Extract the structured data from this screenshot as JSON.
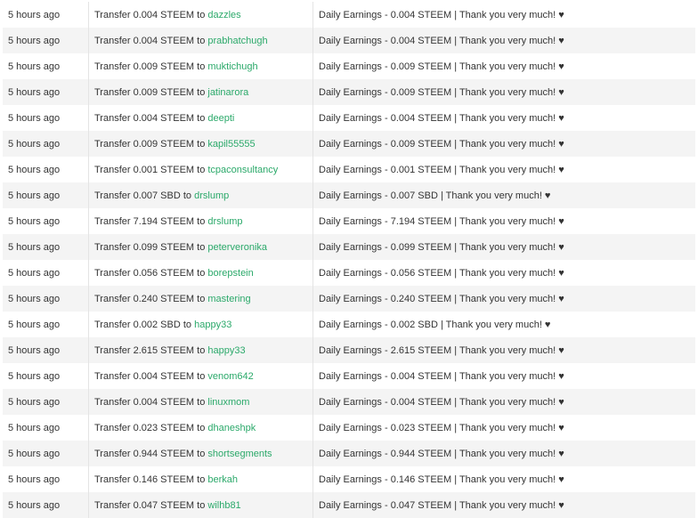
{
  "transfers": [
    {
      "time": "5 hours ago",
      "prefix": "Transfer 0.004 STEEM to",
      "user": "dazzles",
      "memo": "Daily Earnings - 0.004 STEEM | Thank you very much! ♥"
    },
    {
      "time": "5 hours ago",
      "prefix": "Transfer 0.004 STEEM to",
      "user": "prabhatchugh",
      "memo": "Daily Earnings - 0.004 STEEM | Thank you very much! ♥"
    },
    {
      "time": "5 hours ago",
      "prefix": "Transfer 0.009 STEEM to",
      "user": "muktichugh",
      "memo": "Daily Earnings - 0.009 STEEM | Thank you very much! ♥"
    },
    {
      "time": "5 hours ago",
      "prefix": "Transfer 0.009 STEEM to",
      "user": "jatinarora",
      "memo": "Daily Earnings - 0.009 STEEM | Thank you very much! ♥"
    },
    {
      "time": "5 hours ago",
      "prefix": "Transfer 0.004 STEEM to",
      "user": "deepti",
      "memo": "Daily Earnings - 0.004 STEEM | Thank you very much! ♥"
    },
    {
      "time": "5 hours ago",
      "prefix": "Transfer 0.009 STEEM to",
      "user": "kapil55555",
      "memo": "Daily Earnings - 0.009 STEEM | Thank you very much! ♥"
    },
    {
      "time": "5 hours ago",
      "prefix": "Transfer 0.001 STEEM to",
      "user": "tcpaconsultancy",
      "memo": "Daily Earnings - 0.001 STEEM | Thank you very much! ♥"
    },
    {
      "time": "5 hours ago",
      "prefix": "Transfer 0.007 SBD to",
      "user": "drslump",
      "memo": "Daily Earnings - 0.007 SBD | Thank you very much! ♥"
    },
    {
      "time": "5 hours ago",
      "prefix": "Transfer 7.194 STEEM to",
      "user": "drslump",
      "memo": "Daily Earnings - 7.194 STEEM | Thank you very much! ♥"
    },
    {
      "time": "5 hours ago",
      "prefix": "Transfer 0.099 STEEM to",
      "user": "peterveronika",
      "memo": "Daily Earnings - 0.099 STEEM | Thank you very much! ♥"
    },
    {
      "time": "5 hours ago",
      "prefix": "Transfer 0.056 STEEM to",
      "user": "borepstein",
      "memo": "Daily Earnings - 0.056 STEEM | Thank you very much! ♥"
    },
    {
      "time": "5 hours ago",
      "prefix": "Transfer 0.240 STEEM to",
      "user": "mastering",
      "memo": "Daily Earnings - 0.240 STEEM | Thank you very much! ♥"
    },
    {
      "time": "5 hours ago",
      "prefix": "Transfer 0.002 SBD to",
      "user": "happy33",
      "memo": "Daily Earnings - 0.002 SBD | Thank you very much! ♥"
    },
    {
      "time": "5 hours ago",
      "prefix": "Transfer 2.615 STEEM to",
      "user": "happy33",
      "memo": "Daily Earnings - 2.615 STEEM | Thank you very much! ♥"
    },
    {
      "time": "5 hours ago",
      "prefix": "Transfer 0.004 STEEM to",
      "user": "venom642",
      "memo": "Daily Earnings - 0.004 STEEM | Thank you very much! ♥"
    },
    {
      "time": "5 hours ago",
      "prefix": "Transfer 0.004 STEEM to",
      "user": "linuxmom",
      "memo": "Daily Earnings - 0.004 STEEM | Thank you very much! ♥"
    },
    {
      "time": "5 hours ago",
      "prefix": "Transfer 0.023 STEEM to",
      "user": "dhaneshpk",
      "memo": "Daily Earnings - 0.023 STEEM | Thank you very much! ♥"
    },
    {
      "time": "5 hours ago",
      "prefix": "Transfer 0.944 STEEM to",
      "user": "shortsegments",
      "memo": "Daily Earnings - 0.944 STEEM | Thank you very much! ♥"
    },
    {
      "time": "5 hours ago",
      "prefix": "Transfer 0.146 STEEM to",
      "user": "berkah",
      "memo": "Daily Earnings - 0.146 STEEM | Thank you very much! ♥"
    },
    {
      "time": "5 hours ago",
      "prefix": "Transfer 0.047 STEEM to",
      "user": "wilhb81",
      "memo": "Daily Earnings - 0.047 STEEM | Thank you very much! ♥"
    }
  ],
  "colors": {
    "link": "#2ba96a",
    "text": "#333333",
    "row_alt": "#f4f4f4"
  }
}
